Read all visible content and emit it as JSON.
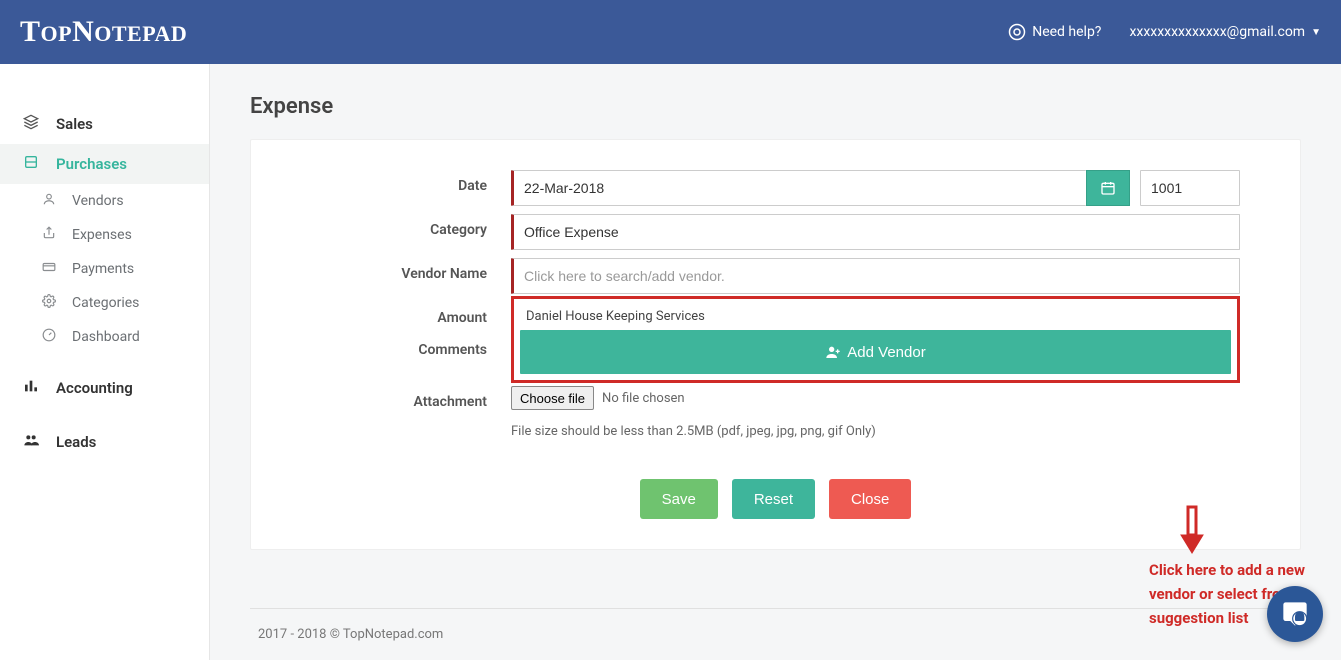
{
  "header": {
    "logo": "TopNotepad",
    "help": "Need help?",
    "user": "xxxxxxxxxxxxxx@gmail.com"
  },
  "sidebar": {
    "sales": "Sales",
    "purchases": "Purchases",
    "sub": {
      "vendors": "Vendors",
      "expenses": "Expenses",
      "payments": "Payments",
      "categories": "Categories",
      "dashboard": "Dashboard"
    },
    "accounting": "Accounting",
    "leads": "Leads"
  },
  "page": {
    "title": "Expense"
  },
  "form": {
    "labels": {
      "date": "Date",
      "category": "Category",
      "vendor": "Vendor Name",
      "amount": "Amount",
      "comments": "Comments",
      "attachment": "Attachment"
    },
    "date_value": "22-Mar-2018",
    "number_value": "1001",
    "category_value": "Office Expense",
    "vendor_placeholder": "Click here to search/add vendor.",
    "vendor_suggestion": "Daniel House Keeping Services",
    "add_vendor_label": "Add Vendor",
    "choose_file": "Choose file",
    "no_file": "No file chosen",
    "file_hint": "File size should be less than 2.5MB (pdf, jpeg, jpg, png, gif Only)"
  },
  "actions": {
    "save": "Save",
    "reset": "Reset",
    "close": "Close"
  },
  "annotation": {
    "text": "Click here to add a new vendor or select from suggestion list"
  },
  "footer": {
    "copyright": "2017 - 2018 © TopNotepad.com"
  }
}
